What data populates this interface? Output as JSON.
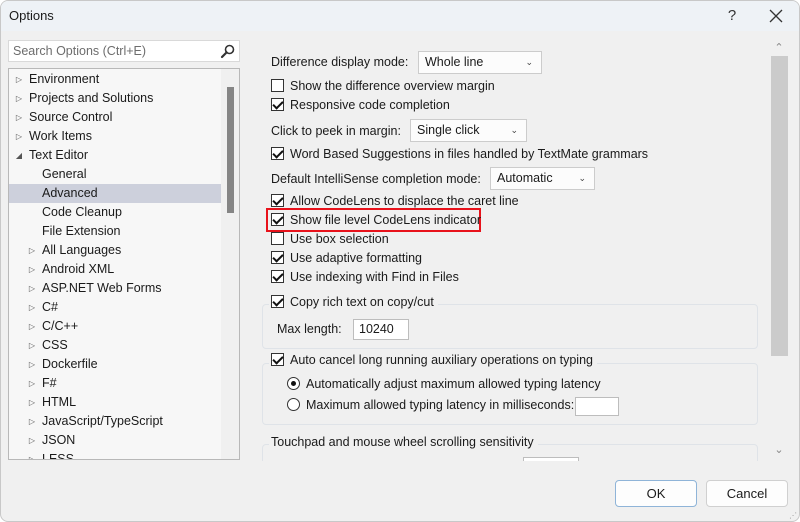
{
  "window": {
    "title": "Options",
    "help_glyph": "?",
    "close_glyph": "✕"
  },
  "search": {
    "placeholder": "Search Options (Ctrl+E)",
    "value": "",
    "icon": "search-icon"
  },
  "tree": {
    "items": [
      {
        "label": "Environment",
        "level": 0,
        "expander": "collapsed"
      },
      {
        "label": "Projects and Solutions",
        "level": 0,
        "expander": "collapsed"
      },
      {
        "label": "Source Control",
        "level": 0,
        "expander": "collapsed"
      },
      {
        "label": "Work Items",
        "level": 0,
        "expander": "collapsed"
      },
      {
        "label": "Text Editor",
        "level": 0,
        "expander": "expanded"
      },
      {
        "label": "General",
        "level": 1,
        "expander": "none"
      },
      {
        "label": "Advanced",
        "level": 1,
        "expander": "none",
        "selected": true
      },
      {
        "label": "Code Cleanup",
        "level": 1,
        "expander": "none"
      },
      {
        "label": "File Extension",
        "level": 1,
        "expander": "none"
      },
      {
        "label": "All Languages",
        "level": 1,
        "expander": "collapsed"
      },
      {
        "label": "Android XML",
        "level": 1,
        "expander": "collapsed"
      },
      {
        "label": "ASP.NET Web Forms",
        "level": 1,
        "expander": "collapsed"
      },
      {
        "label": "C#",
        "level": 1,
        "expander": "collapsed"
      },
      {
        "label": "C/C++",
        "level": 1,
        "expander": "collapsed"
      },
      {
        "label": "CSS",
        "level": 1,
        "expander": "collapsed"
      },
      {
        "label": "Dockerfile",
        "level": 1,
        "expander": "collapsed"
      },
      {
        "label": "F#",
        "level": 1,
        "expander": "collapsed"
      },
      {
        "label": "HTML",
        "level": 1,
        "expander": "collapsed"
      },
      {
        "label": "JavaScript/TypeScript",
        "level": 1,
        "expander": "collapsed"
      },
      {
        "label": "JSON",
        "level": 1,
        "expander": "collapsed"
      },
      {
        "label": "LESS",
        "level": 1,
        "expander": "collapsed"
      }
    ]
  },
  "settings": {
    "difference_display_mode": {
      "label": "Difference display mode:",
      "value": "Whole line"
    },
    "show_difference_overview_margin": {
      "label": "Show the difference overview margin",
      "checked": false
    },
    "responsive_code_completion": {
      "label": "Responsive code completion",
      "checked": true
    },
    "click_to_peek": {
      "label": "Click to peek in margin:",
      "value": "Single click"
    },
    "word_based_suggestions": {
      "label": "Word Based Suggestions in files handled by TextMate grammars",
      "checked": true
    },
    "intellisense_mode": {
      "label": "Default IntelliSense completion mode:",
      "value": "Automatic"
    },
    "allow_codelens_displace": {
      "label": "Allow CodeLens to displace the caret line",
      "checked": true
    },
    "show_file_level_codelens": {
      "label": "Show file level CodeLens indicator",
      "checked": true,
      "highlighted": true
    },
    "use_box_selection": {
      "label": "Use box selection",
      "checked": false
    },
    "use_adaptive_formatting": {
      "label": "Use adaptive formatting",
      "checked": true
    },
    "use_indexing_find_in_files": {
      "label": "Use indexing with Find in Files",
      "checked": true
    },
    "copy_rich_text": {
      "label": "Copy rich text on copy/cut",
      "checked": true
    },
    "max_length": {
      "label": "Max length:",
      "value": "10240"
    },
    "auto_cancel": {
      "label": "Auto cancel long running auxiliary operations on typing",
      "checked": true
    },
    "auto_adjust_latency": {
      "label": "Automatically adjust maximum allowed typing latency",
      "selected": true
    },
    "max_latency_ms": {
      "label": "Maximum allowed typing latency in milliseconds:",
      "selected": false,
      "value": ""
    },
    "touchpad_group": {
      "label": "Touchpad and mouse wheel scrolling sensitivity"
    }
  },
  "colors": {
    "highlight_border": "#e8121b",
    "selected_tree_item": "#cdd0dc",
    "ok_border": "#8fb4d8"
  },
  "buttons": {
    "ok": "OK",
    "cancel": "Cancel"
  },
  "glyphs": {
    "collapsed": "▷",
    "expanded": "◢",
    "combo_chevron": "⌄",
    "scroll_up": "⌃",
    "scroll_down": "⌄"
  }
}
